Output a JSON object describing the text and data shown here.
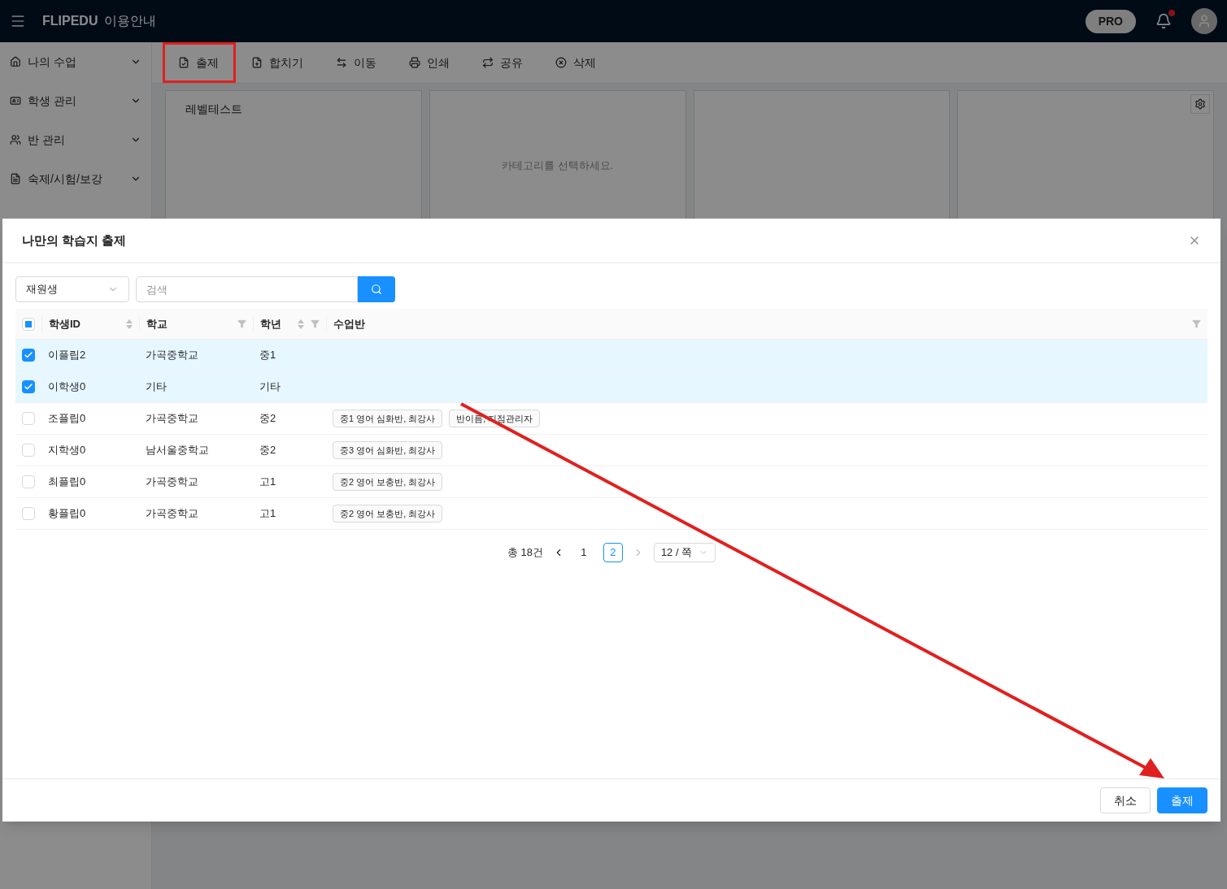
{
  "header": {
    "logo": "FLIPEDU",
    "guide": "이용안내",
    "plan": "PRO",
    "unread": true
  },
  "sidebar": {
    "items": [
      {
        "label": "나의 수업",
        "kind": "home"
      },
      {
        "label": "학생 관리",
        "kind": "card"
      },
      {
        "label": "반 관리",
        "kind": "group"
      },
      {
        "label": "숙제/시험/보강",
        "kind": "file"
      }
    ]
  },
  "toolbar": {
    "buttons": [
      {
        "label": "출제",
        "kind": "assign"
      },
      {
        "label": "합치기",
        "kind": "merge"
      },
      {
        "label": "이동",
        "kind": "move"
      },
      {
        "label": "인쇄",
        "kind": "print"
      },
      {
        "label": "공유",
        "kind": "share"
      },
      {
        "label": "삭제",
        "kind": "delete"
      }
    ]
  },
  "cards": [
    {
      "kind": "titled",
      "text": "레벨테스트"
    },
    {
      "kind": "message",
      "text": "카테고리를 선택하세요."
    },
    {
      "kind": "empty"
    },
    {
      "kind": "settings"
    }
  ],
  "modal": {
    "title": "나만의 학습지 출제",
    "filter": {
      "value": "재원생"
    },
    "search": {
      "placeholder": "검색"
    },
    "table": {
      "indeterminate": true,
      "columns": [
        {
          "label": "학생ID",
          "sortable": true,
          "filterable": false
        },
        {
          "label": "학교",
          "sortable": false,
          "filterable": true
        },
        {
          "label": "학년",
          "sortable": true,
          "filterable": true
        },
        {
          "label": "수업반",
          "sortable": false,
          "filterable": true
        }
      ],
      "rows": [
        {
          "selected": true,
          "id": "이플립2",
          "school": "가곡중학교",
          "grade": "중1"
        },
        {
          "selected": true,
          "id": "이학생0",
          "school": "기타",
          "grade": "기타"
        },
        {
          "selected": false,
          "id": "조플립0",
          "school": "가곡중학교",
          "grade": "중2",
          "classes": [
            "중1 영어 심화반, 최강사",
            "반이름, 지점관리자"
          ]
        },
        {
          "selected": false,
          "id": "지학생0",
          "school": "남서울중학교",
          "grade": "중2",
          "classes": [
            "중3 영어 심화반, 최강사"
          ]
        },
        {
          "selected": false,
          "id": "최플립0",
          "school": "가곡중학교",
          "grade": "고1",
          "classes": [
            "중2 영어 보충반, 최강사"
          ]
        },
        {
          "selected": false,
          "id": "황플립0",
          "school": "가곡중학교",
          "grade": "고1",
          "classes": [
            "중2 영어 보충반, 최강사"
          ]
        }
      ]
    },
    "pagination": {
      "total": "총 18건",
      "prev": {
        "disabled": false
      },
      "next": {
        "disabled": true
      },
      "pages": [
        {
          "label": "1",
          "selected": false
        },
        {
          "label": "2",
          "selected": true
        }
      ],
      "page_size": "12 / 쪽"
    },
    "buttons": [
      {
        "label": "취소",
        "kind": "cancel"
      },
      {
        "label": "출제",
        "kind": "primary"
      }
    ]
  }
}
